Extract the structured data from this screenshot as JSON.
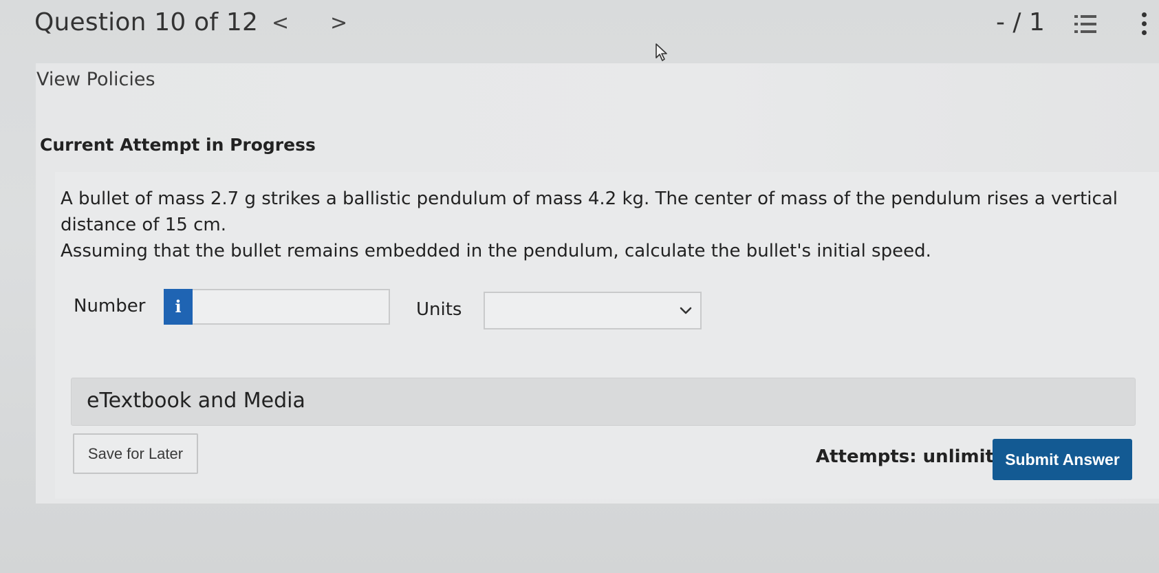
{
  "header": {
    "question_title": "Question 10 of 12",
    "prev_glyph": "<",
    "next_glyph": ">",
    "score": "- / 1",
    "list_icon": "list-icon",
    "more_icon": "kebab-menu-icon"
  },
  "policies": {
    "link_label": "View Policies"
  },
  "attempt": {
    "heading": "Current Attempt in Progress"
  },
  "question": {
    "line1": "A bullet of mass 2.7 g strikes a ballistic pendulum of mass 4.2 kg. The center of mass of the pendulum rises a vertical distance of 15 cm.",
    "line2": "Assuming that the bullet remains embedded in the pendulum, calculate the bullet's initial speed."
  },
  "answer": {
    "number_label": "Number",
    "number_value": "",
    "info_glyph": "i",
    "units_label": "Units",
    "units_selected": ""
  },
  "resources": {
    "etextbook_label": "eTextbook and Media"
  },
  "footer": {
    "save_label": "Save for Later",
    "attempts_text": "Attempts: unlimited",
    "submit_label": "Submit Answer"
  },
  "colors": {
    "submit_bg": "#135a93",
    "info_bg": "#1f64b3",
    "page_bg": "#d9dbdc"
  }
}
